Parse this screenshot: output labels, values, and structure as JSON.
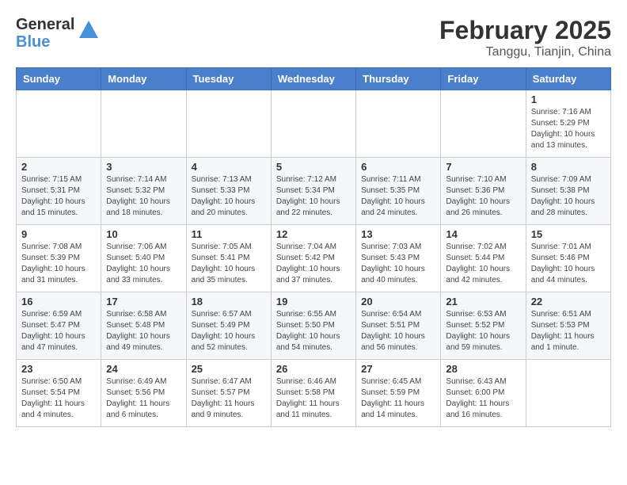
{
  "header": {
    "logo_general": "General",
    "logo_blue": "Blue",
    "month": "February 2025",
    "location": "Tanggu, Tianjin, China"
  },
  "weekdays": [
    "Sunday",
    "Monday",
    "Tuesday",
    "Wednesday",
    "Thursday",
    "Friday",
    "Saturday"
  ],
  "weeks": [
    [
      {
        "day": "",
        "info": ""
      },
      {
        "day": "",
        "info": ""
      },
      {
        "day": "",
        "info": ""
      },
      {
        "day": "",
        "info": ""
      },
      {
        "day": "",
        "info": ""
      },
      {
        "day": "",
        "info": ""
      },
      {
        "day": "1",
        "info": "Sunrise: 7:16 AM\nSunset: 5:29 PM\nDaylight: 10 hours\nand 13 minutes."
      }
    ],
    [
      {
        "day": "2",
        "info": "Sunrise: 7:15 AM\nSunset: 5:31 PM\nDaylight: 10 hours\nand 15 minutes."
      },
      {
        "day": "3",
        "info": "Sunrise: 7:14 AM\nSunset: 5:32 PM\nDaylight: 10 hours\nand 18 minutes."
      },
      {
        "day": "4",
        "info": "Sunrise: 7:13 AM\nSunset: 5:33 PM\nDaylight: 10 hours\nand 20 minutes."
      },
      {
        "day": "5",
        "info": "Sunrise: 7:12 AM\nSunset: 5:34 PM\nDaylight: 10 hours\nand 22 minutes."
      },
      {
        "day": "6",
        "info": "Sunrise: 7:11 AM\nSunset: 5:35 PM\nDaylight: 10 hours\nand 24 minutes."
      },
      {
        "day": "7",
        "info": "Sunrise: 7:10 AM\nSunset: 5:36 PM\nDaylight: 10 hours\nand 26 minutes."
      },
      {
        "day": "8",
        "info": "Sunrise: 7:09 AM\nSunset: 5:38 PM\nDaylight: 10 hours\nand 28 minutes."
      }
    ],
    [
      {
        "day": "9",
        "info": "Sunrise: 7:08 AM\nSunset: 5:39 PM\nDaylight: 10 hours\nand 31 minutes."
      },
      {
        "day": "10",
        "info": "Sunrise: 7:06 AM\nSunset: 5:40 PM\nDaylight: 10 hours\nand 33 minutes."
      },
      {
        "day": "11",
        "info": "Sunrise: 7:05 AM\nSunset: 5:41 PM\nDaylight: 10 hours\nand 35 minutes."
      },
      {
        "day": "12",
        "info": "Sunrise: 7:04 AM\nSunset: 5:42 PM\nDaylight: 10 hours\nand 37 minutes."
      },
      {
        "day": "13",
        "info": "Sunrise: 7:03 AM\nSunset: 5:43 PM\nDaylight: 10 hours\nand 40 minutes."
      },
      {
        "day": "14",
        "info": "Sunrise: 7:02 AM\nSunset: 5:44 PM\nDaylight: 10 hours\nand 42 minutes."
      },
      {
        "day": "15",
        "info": "Sunrise: 7:01 AM\nSunset: 5:46 PM\nDaylight: 10 hours\nand 44 minutes."
      }
    ],
    [
      {
        "day": "16",
        "info": "Sunrise: 6:59 AM\nSunset: 5:47 PM\nDaylight: 10 hours\nand 47 minutes."
      },
      {
        "day": "17",
        "info": "Sunrise: 6:58 AM\nSunset: 5:48 PM\nDaylight: 10 hours\nand 49 minutes."
      },
      {
        "day": "18",
        "info": "Sunrise: 6:57 AM\nSunset: 5:49 PM\nDaylight: 10 hours\nand 52 minutes."
      },
      {
        "day": "19",
        "info": "Sunrise: 6:55 AM\nSunset: 5:50 PM\nDaylight: 10 hours\nand 54 minutes."
      },
      {
        "day": "20",
        "info": "Sunrise: 6:54 AM\nSunset: 5:51 PM\nDaylight: 10 hours\nand 56 minutes."
      },
      {
        "day": "21",
        "info": "Sunrise: 6:53 AM\nSunset: 5:52 PM\nDaylight: 10 hours\nand 59 minutes."
      },
      {
        "day": "22",
        "info": "Sunrise: 6:51 AM\nSunset: 5:53 PM\nDaylight: 11 hours\nand 1 minute."
      }
    ],
    [
      {
        "day": "23",
        "info": "Sunrise: 6:50 AM\nSunset: 5:54 PM\nDaylight: 11 hours\nand 4 minutes."
      },
      {
        "day": "24",
        "info": "Sunrise: 6:49 AM\nSunset: 5:56 PM\nDaylight: 11 hours\nand 6 minutes."
      },
      {
        "day": "25",
        "info": "Sunrise: 6:47 AM\nSunset: 5:57 PM\nDaylight: 11 hours\nand 9 minutes."
      },
      {
        "day": "26",
        "info": "Sunrise: 6:46 AM\nSunset: 5:58 PM\nDaylight: 11 hours\nand 11 minutes."
      },
      {
        "day": "27",
        "info": "Sunrise: 6:45 AM\nSunset: 5:59 PM\nDaylight: 11 hours\nand 14 minutes."
      },
      {
        "day": "28",
        "info": "Sunrise: 6:43 AM\nSunset: 6:00 PM\nDaylight: 11 hours\nand 16 minutes."
      },
      {
        "day": "",
        "info": ""
      }
    ]
  ]
}
